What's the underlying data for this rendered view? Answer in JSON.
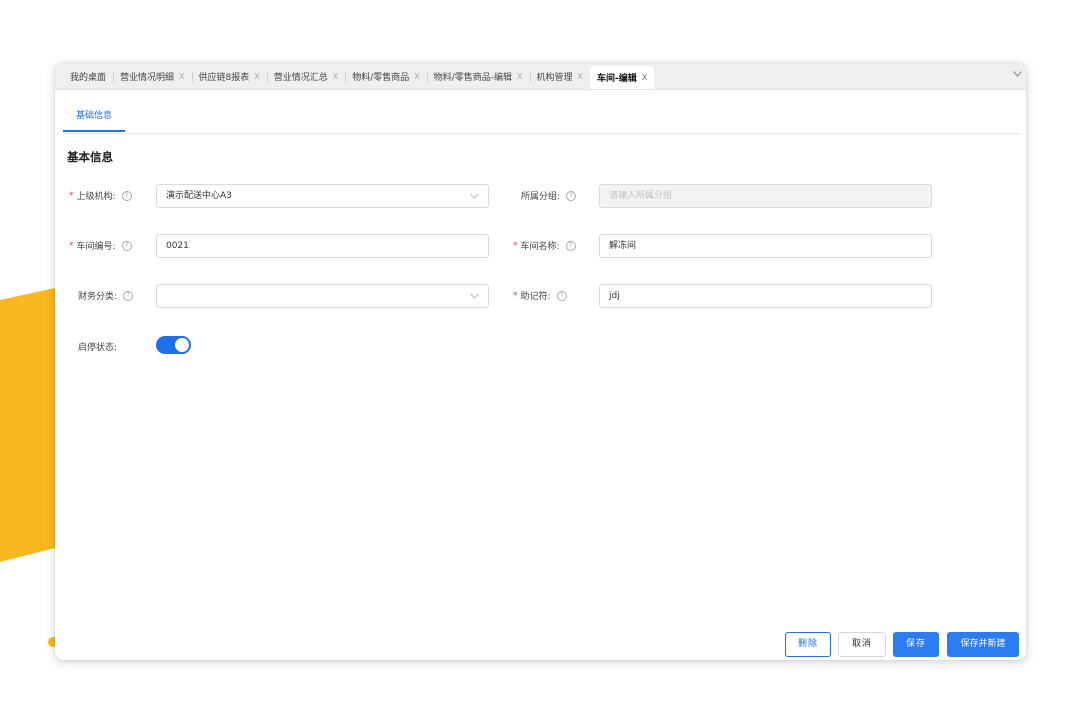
{
  "tabs": [
    {
      "label": "我的桌面",
      "close": ""
    },
    {
      "label": "营业情况明细",
      "close": "X"
    },
    {
      "label": "供应链8报表",
      "close": "X"
    },
    {
      "label": "营业情况汇总",
      "close": "X"
    },
    {
      "label": "物料/零售商品",
      "close": "X"
    },
    {
      "label": "物料/零售商品-编辑",
      "close": "X"
    },
    {
      "label": "机构管理",
      "close": "X"
    },
    {
      "label": "车间-编辑",
      "close": "X"
    }
  ],
  "active_tab": "车间-编辑",
  "subtab": "基础信息",
  "section_title": "基本信息",
  "form": {
    "parent_org": {
      "label": "上级机构:",
      "value": "演示配送中心A3"
    },
    "group": {
      "label": "所属分组:",
      "placeholder": "请输入所属分组"
    },
    "workshop_code": {
      "label": "车间编号:",
      "value": "0021"
    },
    "workshop_name": {
      "label": "车间名称:",
      "value": "解冻间"
    },
    "finance_category": {
      "label": "财务分类:",
      "value": ""
    },
    "mnemonic": {
      "label": "助记符:",
      "value": "jdj"
    },
    "status": {
      "label": "启停状态:",
      "enabled": true
    }
  },
  "buttons": {
    "delete": "删除",
    "cancel": "取消",
    "save": "保存",
    "save_new": "保存并新建"
  },
  "colors": {
    "accent": "#1f6fe8",
    "required": "#e23b3b",
    "decor_yellow": "#f9b81f"
  },
  "icons": {
    "help": "question-circle-icon",
    "dropdown": "chevron-down-icon",
    "more": "chevron-down-icon"
  }
}
